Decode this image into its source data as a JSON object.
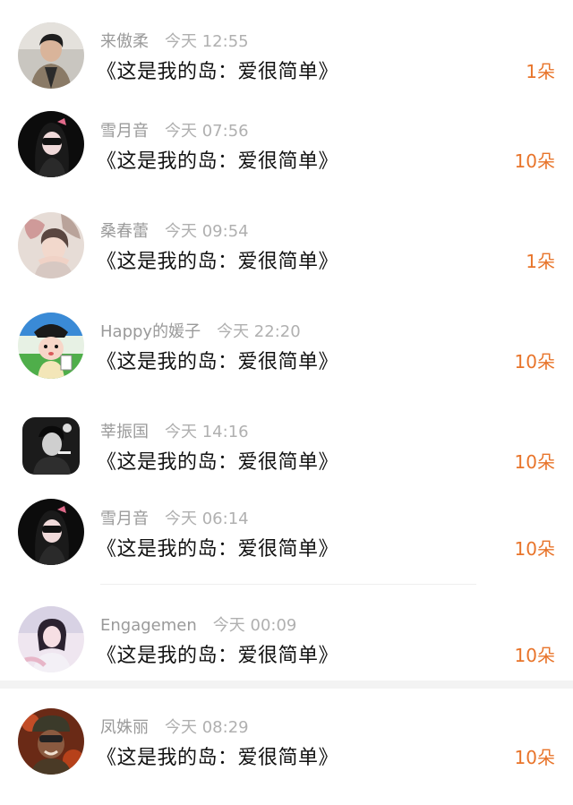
{
  "gift_list": [
    {
      "name": "来傲柔",
      "time": "今天 12:55",
      "title": "《这是我的岛：爱很简单》",
      "count": "1朵",
      "avatar": "man-jacket-avatar"
    },
    {
      "name": "雪月音",
      "time": "今天 07:56",
      "title": "《这是我的岛：爱很简单》",
      "count": "10朵",
      "avatar": "girl-sunglasses-avatar"
    },
    {
      "name": "桑春蕾",
      "time": "今天 09:54",
      "title": "《这是我的岛：爱很简单》",
      "count": "1朵",
      "avatar": "girl-hands-avatar"
    },
    {
      "name": "Happy的媛子",
      "time": "今天 22:20",
      "title": "《这是我的岛：爱很简单》",
      "count": "10朵",
      "avatar": "cartoon-official-avatar"
    },
    {
      "name": "莘振国",
      "time": "今天 14:16",
      "title": "《这是我的岛：爱很简单》",
      "count": "10朵",
      "avatar": "man-mono-avatar"
    },
    {
      "name": "雪月音",
      "time": "今天 06:14",
      "title": "《这是我的岛：爱很简单》",
      "count": "10朵",
      "avatar": "girl-sunglasses-avatar"
    },
    {
      "name": "Engagemen",
      "time": "今天 00:09",
      "title": "《这是我的岛：爱很简单》",
      "count": "10朵",
      "avatar": "girl-pastel-avatar"
    },
    {
      "name": "凤姝丽",
      "time": "今天 08:29",
      "title": "《这是我的岛：爱很简单》",
      "count": "10朵",
      "avatar": "soldier-avatar"
    }
  ],
  "colors": {
    "accent": "#e8742a",
    "meta": "#9a9a9a",
    "title": "#111111"
  }
}
